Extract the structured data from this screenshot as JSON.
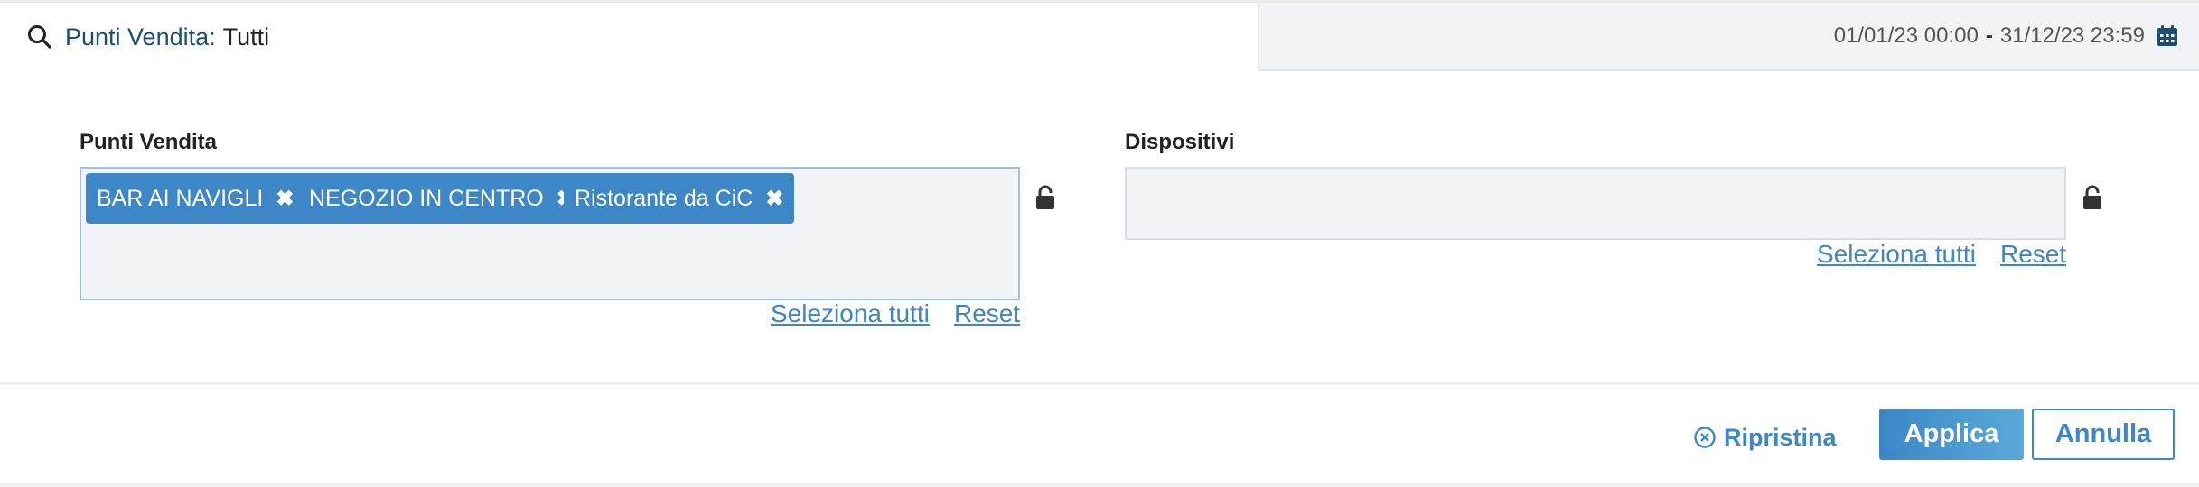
{
  "search": {
    "label": "Punti Vendita:",
    "value": "Tutti"
  },
  "date_range": {
    "start": "01/01/23 00:00",
    "separator": "-",
    "end": "31/12/23 23:59"
  },
  "points_of_sale": {
    "label": "Punti Vendita",
    "tags": [
      "BAR AI NAVIGLI",
      "NEGOZIO IN CENTRO",
      "Ristorante da CiC"
    ],
    "select_all": "Seleziona tutti",
    "reset": "Reset"
  },
  "devices": {
    "label": "Dispositivi",
    "select_all": "Seleziona tutti",
    "reset": "Reset"
  },
  "footer": {
    "restore": "Ripristina",
    "apply": "Applica",
    "cancel": "Annulla"
  },
  "colors": {
    "accent": "#3d87c6",
    "title_blue": "#1e4d73",
    "field_bg": "#f2f3f6"
  }
}
